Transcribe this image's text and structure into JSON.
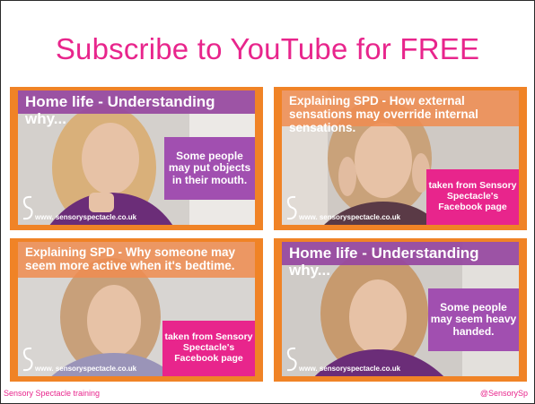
{
  "title": "Subscribe to YouTube for FREE",
  "thumbnails": [
    {
      "banner": "Home life - Understanding why...",
      "caption": "Some people may put objects in their mouth.",
      "website": "www. sensoryspectacle.co.uk"
    },
    {
      "banner": "Explaining SPD - How external sensations may override internal sensations.",
      "caption": "taken from Sensory Spectacle's Facebook page",
      "website": "www. sensoryspectacle.co.uk"
    },
    {
      "banner": "Explaining SPD - Why someone may seem more active when it's bedtime.",
      "caption": "taken from Sensory Spectacle's Facebook page",
      "website": "www. sensoryspectacle.co.uk"
    },
    {
      "banner": "Home life - Understanding why...",
      "caption": "Some people may seem heavy handed.",
      "website": "www. sensoryspectacle.co.uk"
    }
  ],
  "footer": {
    "left": "Sensory Spectacle training",
    "right": "@SensorySp"
  },
  "colors": {
    "brand_pink": "#e8258c",
    "border_orange": "#f08326",
    "caption_purple": "#a14fb0"
  }
}
